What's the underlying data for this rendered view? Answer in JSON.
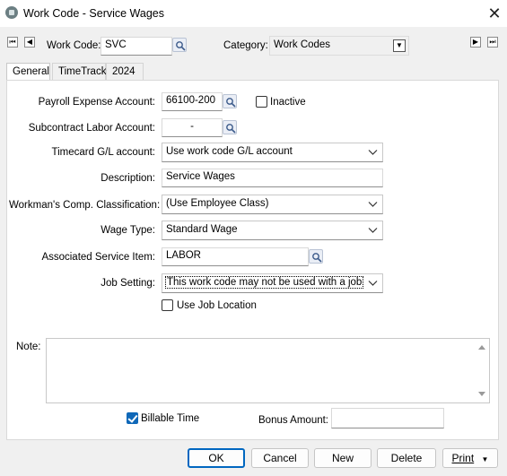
{
  "window": {
    "title": "Work Code - Service Wages"
  },
  "header": {
    "work_code_label": "Work Code:",
    "work_code_value": "SVC",
    "category_label": "Category:",
    "category_value": "Work Codes"
  },
  "tabs": [
    {
      "label": "General",
      "active": true
    },
    {
      "label": "TimeTrack",
      "active": false
    },
    {
      "label": "2024",
      "active": false
    }
  ],
  "general": {
    "payroll_expense_label": "Payroll Expense Account:",
    "payroll_expense_value": "66100-200",
    "inactive_label": "Inactive",
    "inactive_checked": false,
    "subcontract_label": "Subcontract Labor Account:",
    "subcontract_value": "-",
    "timecard_label": "Timecard G/L account:",
    "timecard_value": "Use work code G/L account",
    "description_label": "Description:",
    "description_value": "Service Wages",
    "workmans_comp_label": "Workman's Comp. Classification:",
    "workmans_comp_value": "(Use Employee Class)",
    "wage_type_label": "Wage Type:",
    "wage_type_value": "Standard Wage",
    "service_item_label": "Associated Service Item:",
    "service_item_value": "LABOR",
    "job_setting_label": "Job Setting:",
    "job_setting_value": "This work code may not be used with a job",
    "use_job_location_label": "Use Job Location",
    "use_job_location_checked": false,
    "note_label": "Note:",
    "note_value": "",
    "billable_time_label": "Billable Time",
    "billable_time_checked": true,
    "bonus_amount_label": "Bonus Amount:",
    "bonus_amount_value": ""
  },
  "buttons": {
    "ok": "OK",
    "cancel": "Cancel",
    "new": "New",
    "delete": "Delete",
    "print": "Print"
  },
  "colors": {
    "accent": "#0067c0",
    "checkbox_checked": "#0f68b8",
    "panel_bg": "#ffffff",
    "window_bg": "#f0f0f0"
  }
}
